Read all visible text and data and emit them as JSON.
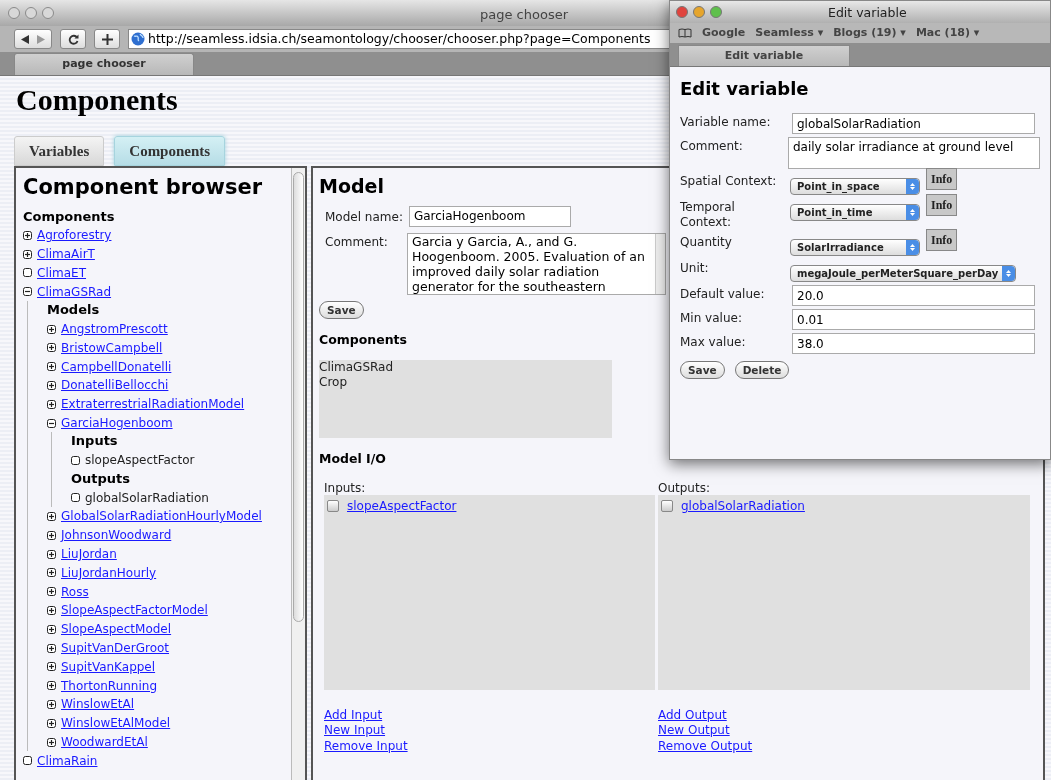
{
  "main_window": {
    "title": "page chooser",
    "url": "http://seamless.idsia.ch/seamontology/chooser/chooser.php?page=Components",
    "tab": "page chooser"
  },
  "page": {
    "heading": "Components",
    "tabs": [
      {
        "label": "Variables",
        "selected": false
      },
      {
        "label": "Components",
        "selected": true
      }
    ]
  },
  "browser": {
    "title": "Component browser",
    "heading": "Components",
    "items": [
      {
        "kind": "expandable",
        "label": "Agroforestry",
        "expanded": false
      },
      {
        "kind": "expandable",
        "label": "ClimaAirT",
        "expanded": false
      },
      {
        "kind": "leaf",
        "label": "ClimaET"
      },
      {
        "kind": "expandable",
        "label": "ClimaGSRad",
        "expanded": true,
        "sections": [
          {
            "heading": "Models",
            "items": [
              {
                "kind": "expandable",
                "label": "AngstromPrescott",
                "expanded": false
              },
              {
                "kind": "expandable",
                "label": "BristowCampbell",
                "expanded": false
              },
              {
                "kind": "expandable",
                "label": "CampbellDonatelli",
                "expanded": false
              },
              {
                "kind": "expandable",
                "label": "DonatelliBellocchi",
                "expanded": false
              },
              {
                "kind": "expandable",
                "label": "ExtraterrestrialRadiationModel",
                "expanded": false
              },
              {
                "kind": "expandable",
                "label": "GarciaHogenboom",
                "expanded": true,
                "sections": [
                  {
                    "heading": "Inputs",
                    "items": [
                      {
                        "kind": "variable",
                        "label": "slopeAspectFactor"
                      }
                    ]
                  },
                  {
                    "heading": "Outputs",
                    "items": [
                      {
                        "kind": "variable",
                        "label": "globalSolarRadiation"
                      }
                    ]
                  }
                ]
              },
              {
                "kind": "expandable",
                "label": "GlobalSolarRadiationHourlyModel",
                "expanded": false
              },
              {
                "kind": "expandable",
                "label": "JohnsonWoodward",
                "expanded": false
              },
              {
                "kind": "expandable",
                "label": "LiuJordan",
                "expanded": false
              },
              {
                "kind": "expandable",
                "label": "LiuJordanHourly",
                "expanded": false
              },
              {
                "kind": "expandable",
                "label": "Ross",
                "expanded": false
              },
              {
                "kind": "expandable",
                "label": "SlopeAspectFactorModel",
                "expanded": false
              },
              {
                "kind": "expandable",
                "label": "SlopeAspectModel",
                "expanded": false
              },
              {
                "kind": "expandable",
                "label": "SupitVanDerGroot",
                "expanded": false
              },
              {
                "kind": "expandable",
                "label": "SupitVanKappel",
                "expanded": false
              },
              {
                "kind": "expandable",
                "label": "ThortonRunning",
                "expanded": false
              },
              {
                "kind": "expandable",
                "label": "WinslowEtAl",
                "expanded": false
              },
              {
                "kind": "expandable",
                "label": "WinslowEtAlModel",
                "expanded": false
              },
              {
                "kind": "expandable",
                "label": "WoodwardEtAl",
                "expanded": false
              }
            ]
          }
        ]
      },
      {
        "kind": "leaf",
        "label": "ClimaRain"
      }
    ]
  },
  "model": {
    "title": "Model",
    "name_label": "Model name:",
    "name_value": "GarciaHogenboom",
    "comment_label": "Comment:",
    "comment_value": "Garcia y Garcia, A., and G. Hoogenboom. 2005. Evaluation of an improved daily solar radiation generator for the southeastern",
    "save": "Save",
    "components_heading": "Components",
    "components": [
      "ClimaGSRad",
      "Crop"
    ],
    "io_heading": "Model I/O",
    "io": [
      {
        "label": "Inputs:",
        "items": [
          {
            "name": "slopeAspectFactor",
            "checked": false
          }
        ],
        "links": [
          "Add Input",
          "New Input",
          "Remove Input"
        ]
      },
      {
        "label": "Outputs:",
        "items": [
          {
            "name": "globalSolarRadiation",
            "checked": false
          }
        ],
        "links": [
          "Add Output",
          "New Output",
          "Remove Output"
        ]
      }
    ]
  },
  "popup": {
    "title": "Edit variable",
    "bookmarks": [
      "Google",
      "Seamless ▾",
      "Blogs (19) ▾",
      "Mac (18) ▾"
    ],
    "tab": "Edit variable",
    "heading": "Edit variable",
    "fields": [
      {
        "kind": "text",
        "label": "Variable name:",
        "value": "globalSolarRadiation"
      },
      {
        "kind": "textarea",
        "label": "Comment:",
        "value": "daily solar irradiance at ground level"
      },
      {
        "kind": "select",
        "label": "Spatial Context:",
        "value": "Point_in_space",
        "info": "Info"
      },
      {
        "kind": "select",
        "label": "Temporal Context:",
        "value": "Point_in_time",
        "info": "Info"
      },
      {
        "kind": "select",
        "label": "Quantity",
        "value": "SolarIrradiance",
        "info": "Info"
      },
      {
        "kind": "select",
        "label": "Unit:",
        "value": "megaJoule_perMeterSquare_perDay"
      },
      {
        "kind": "text",
        "label": "Default value:",
        "value": "20.0"
      },
      {
        "kind": "text",
        "label": "Min value:",
        "value": "0.01"
      },
      {
        "kind": "text",
        "label": "Max value:",
        "value": "38.0"
      }
    ],
    "buttons": [
      "Save",
      "Delete"
    ]
  }
}
